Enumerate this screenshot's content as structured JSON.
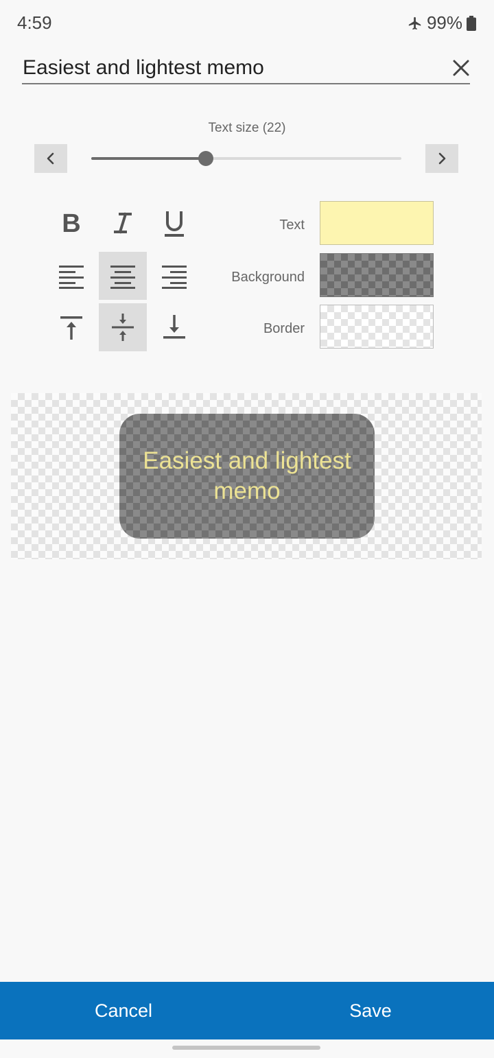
{
  "status_bar": {
    "time": "4:59",
    "battery": "99%",
    "icons": [
      "airplane-mode-icon",
      "battery-icon"
    ]
  },
  "editor": {
    "title_value": "Easiest and lightest memo",
    "close_icon": "close-icon"
  },
  "text_size": {
    "label": "Text size (22)",
    "value_fraction": 0.37,
    "decrease_icon": "chevron-left-icon",
    "increase_icon": "chevron-right-icon"
  },
  "formatting": {
    "style_buttons": [
      {
        "name": "bold",
        "icon": "bold-icon",
        "active": false
      },
      {
        "name": "italic",
        "icon": "italic-icon",
        "active": false
      },
      {
        "name": "underline",
        "icon": "underline-icon",
        "active": false
      }
    ],
    "align_buttons": [
      {
        "name": "align-left",
        "icon": "align-left-icon",
        "active": false
      },
      {
        "name": "align-center",
        "icon": "align-center-icon",
        "active": true
      },
      {
        "name": "align-right",
        "icon": "align-right-icon",
        "active": false
      }
    ],
    "vertical_buttons": [
      {
        "name": "align-top",
        "icon": "align-top-icon",
        "active": false
      },
      {
        "name": "align-middle",
        "icon": "align-middle-icon",
        "active": true
      },
      {
        "name": "align-bottom",
        "icon": "align-bottom-icon",
        "active": false
      }
    ]
  },
  "colors": {
    "text_label": "Text",
    "background_label": "Background",
    "border_label": "Border",
    "text_color": "#fdf5b0",
    "background_color": "#7d7d7d",
    "border_color": "transparent"
  },
  "preview": {
    "memo_text": "Easiest and lightest memo",
    "memo_text_color": "#ece294"
  },
  "actions": {
    "cancel_label": "Cancel",
    "save_label": "Save",
    "bar_color": "#0a72bd"
  }
}
